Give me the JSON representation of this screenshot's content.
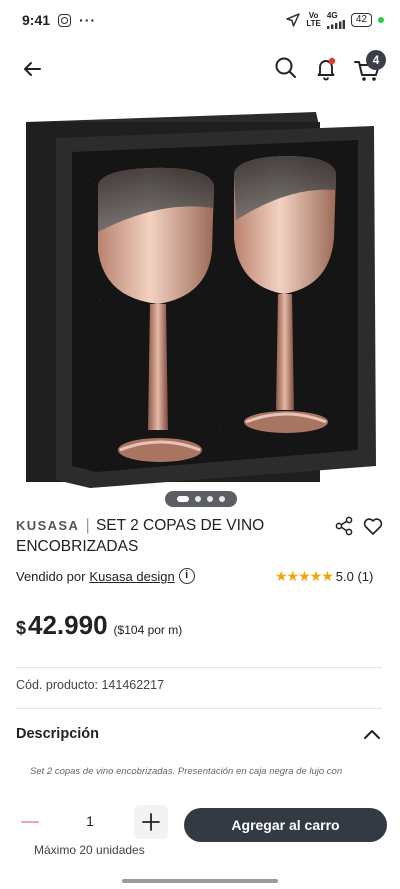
{
  "status_bar": {
    "time": "9:41",
    "dots": "···",
    "network_top": "Vo",
    "network_bottom": "LTE",
    "net_type": "4G",
    "battery": "42",
    "icons": [
      "instagram-icon",
      "location-arrow-icon",
      "signal-icon",
      "battery-icon"
    ]
  },
  "header": {
    "icons": [
      "back-arrow-icon",
      "search-icon",
      "bell-icon",
      "cart-icon"
    ],
    "cart_count": "4",
    "notification_dot_color": "#e53935"
  },
  "carousel": {
    "total": 4,
    "active_index": 0
  },
  "product": {
    "brand": "KUSASA",
    "separator": "|",
    "title": "SET 2 COPAS DE VINO ENCOBRIZADAS",
    "seller_prefix": "Vendido por",
    "seller_name": "Kusasa design",
    "info_icon_glyph": "i",
    "stars": "★★★★★",
    "rating": "5.0 (1)",
    "currency": "$",
    "price": "42.990",
    "price_per_unit": "($104 por m)",
    "code": "Cód. producto: 141462217"
  },
  "description": {
    "header": "Descripción",
    "text": "Set 2 copas de vino encobrizadas. Presentación en caja negra de lujo con"
  },
  "purchase": {
    "minus": "−",
    "quantity": "1",
    "plus": "+",
    "add_to_cart": "Agregar al carro",
    "max_units": "Máximo 20 unidades"
  },
  "colors": {
    "button_dark": "#343a44",
    "star": "#f2a500",
    "copper": "#d9a08a"
  }
}
